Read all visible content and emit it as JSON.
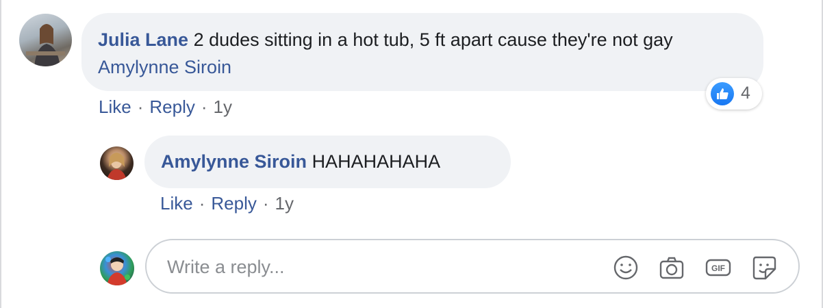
{
  "comment": {
    "author": "Julia Lane",
    "text": "2 dudes sitting in a hot tub, 5 ft apart cause they're not gay",
    "mention": "Amylynne Siroin",
    "reaction_count": "4",
    "actions": {
      "like": "Like",
      "reply": "Reply",
      "time": "1y",
      "separator": "·"
    }
  },
  "reply": {
    "author": "Amylynne Siroin",
    "text": "HAHAHAHAHA",
    "actions": {
      "like": "Like",
      "reply": "Reply",
      "time": "1y",
      "separator": "·"
    }
  },
  "composer": {
    "placeholder": "Write a reply...",
    "tools": [
      "emoji-icon",
      "camera-icon",
      "gif-icon",
      "sticker-icon"
    ]
  },
  "colors": {
    "link": "#385898",
    "bubble": "#f0f2f5",
    "like_blue": "#1877f2",
    "meta": "#65676b"
  }
}
